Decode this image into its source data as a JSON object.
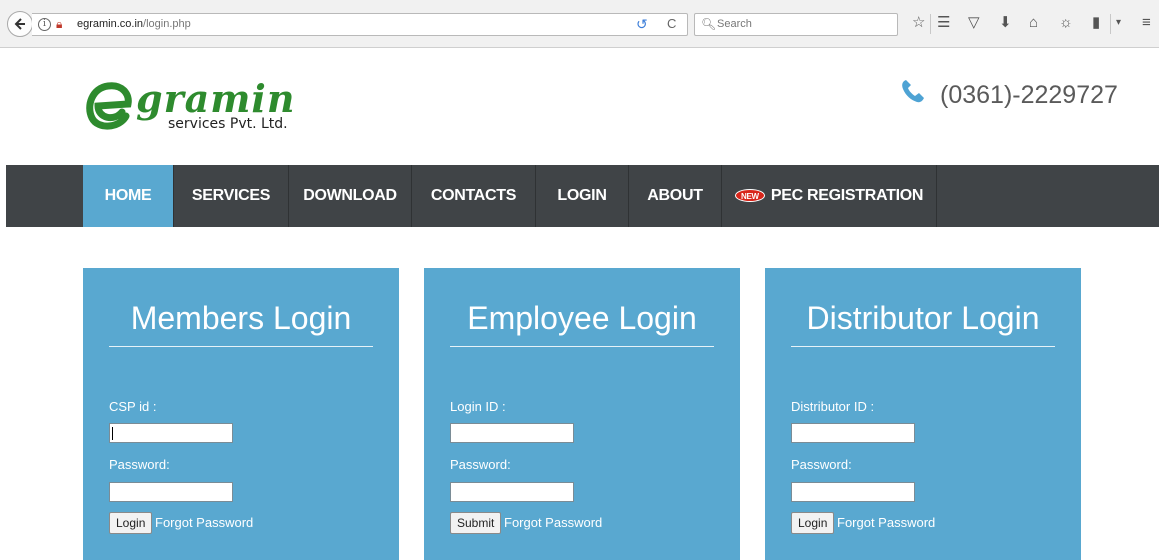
{
  "browser": {
    "url_domain": "egramin.co.in",
    "url_path": "/login.php",
    "search_placeholder": "Search"
  },
  "header": {
    "logo_word": "gramin",
    "logo_sub": "services Pvt. Ltd.",
    "phone": "(0361)-2229727"
  },
  "nav": {
    "items": [
      {
        "label": "HOME"
      },
      {
        "label": "SERVICES"
      },
      {
        "label": "DOWNLOAD"
      },
      {
        "label": "CONTACTS"
      },
      {
        "label": "LOGIN"
      },
      {
        "label": "ABOUT"
      },
      {
        "label": "PEC REGISTRATION",
        "badge": "NEW"
      }
    ]
  },
  "panels": [
    {
      "title": "Members Login",
      "id_label": "CSP id :",
      "password_label": "Password:",
      "button": "Login",
      "forgot": "Forgot Password"
    },
    {
      "title": "Employee Login",
      "id_label": "Login ID :",
      "password_label": "Password:",
      "button": "Submit",
      "forgot": "Forgot Password"
    },
    {
      "title": "Distributor Login",
      "id_label": "Distributor ID :",
      "password_label": "Password:",
      "button": "Login",
      "forgot": "Forgot Password"
    }
  ],
  "colors": {
    "nav_bg": "#404447",
    "accent_blue": "#59a8d0",
    "logo_green": "#2e8b2e"
  }
}
